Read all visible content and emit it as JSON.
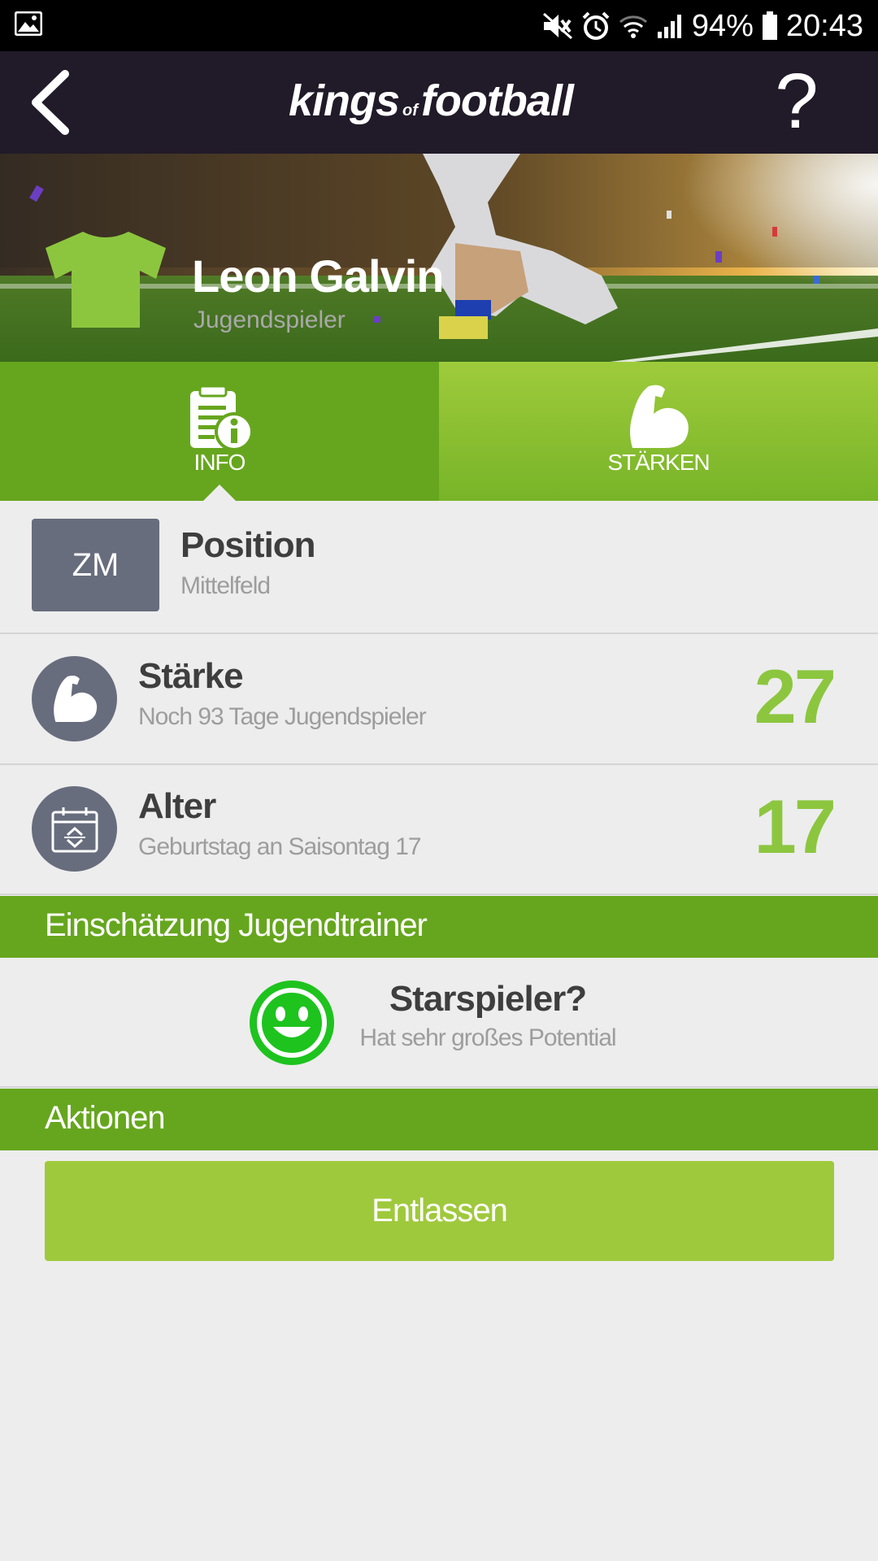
{
  "status_bar": {
    "battery_percent": "94%",
    "time": "20:43",
    "icons": [
      "image-icon",
      "mute-icon",
      "alarm-icon",
      "wifi-icon",
      "signal-icon",
      "battery-icon"
    ]
  },
  "header": {
    "logo_word_1": "kings",
    "logo_word_2": "of",
    "logo_word_3": "football",
    "help_label": "?"
  },
  "player": {
    "name": "Leon Galvin",
    "role": "Jugendspieler",
    "jersey_color": "#8cc63f"
  },
  "tabs": [
    {
      "label": "INFO",
      "icon": "document-info-icon",
      "active": true
    },
    {
      "label": "STÄRKEN",
      "icon": "biceps-icon",
      "active": false
    }
  ],
  "position": {
    "code": "ZM",
    "title": "Position",
    "subtitle": "Mittelfeld"
  },
  "strength": {
    "title": "Stärke",
    "subtitle": "Noch 93 Tage Jugendspieler",
    "value": "27"
  },
  "age": {
    "title": "Alter",
    "subtitle": "Geburtstag an Saisontag 17",
    "value": "17"
  },
  "trainer_section": {
    "header": "Einschätzung Jugendtrainer",
    "title": "Starspieler?",
    "subtitle": "Hat sehr großes Potential"
  },
  "actions_section": {
    "header": "Aktionen",
    "dismiss_label": "Entlassen"
  },
  "colors": {
    "header_bg": "#211a29",
    "green": "#66a61e",
    "light_green": "#9fc93c",
    "value_green": "#8cc63f",
    "slate": "#676d7d",
    "smiley_green": "#1ec31e"
  }
}
